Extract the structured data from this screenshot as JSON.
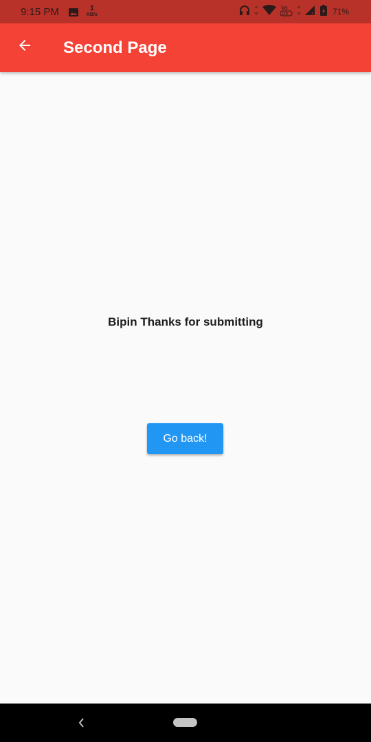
{
  "status_bar": {
    "time": "9:15 PM",
    "net_speed_value": "1",
    "net_speed_unit": "KB/s",
    "battery_percent": "71%",
    "icons": [
      "image-icon",
      "headphones-icon",
      "data-arrows-icon",
      "wifi-icon",
      "volte-icon",
      "signal-icon",
      "battery-icon"
    ]
  },
  "app_bar": {
    "title": "Second Page",
    "color": "#f44336",
    "back_icon": "arrow-back-icon"
  },
  "main": {
    "message": "Bipin Thanks for submitting",
    "go_back_label": "Go back!",
    "button_color": "#2196f3"
  },
  "nav_bar": {
    "icons": [
      "nav-back-icon",
      "nav-home-pill"
    ]
  }
}
